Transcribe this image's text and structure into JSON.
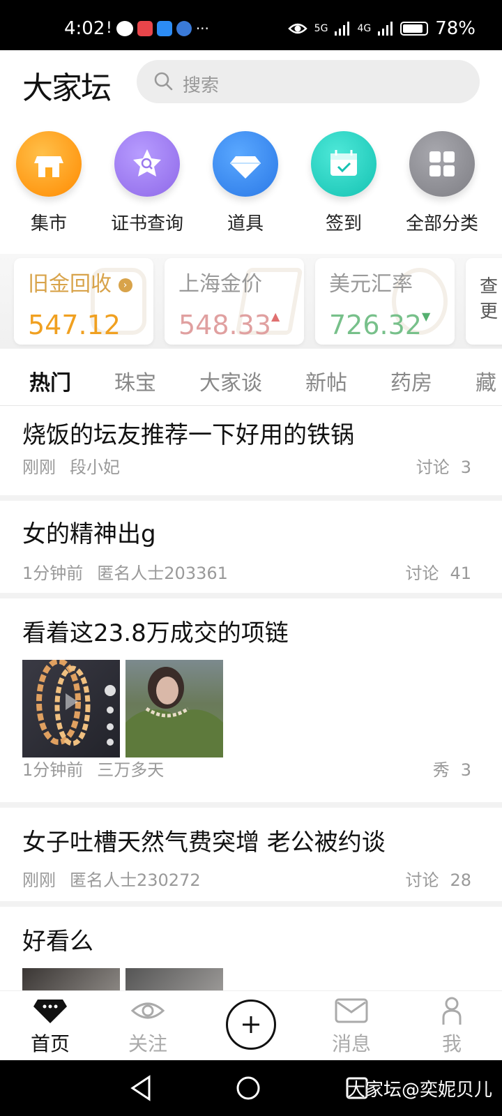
{
  "status_bar": {
    "time": "4:02",
    "network_1": "5G",
    "network_2": "4G",
    "battery": "78%"
  },
  "header": {
    "logo": "大家坛",
    "search_placeholder": "搜索"
  },
  "categories": [
    {
      "label": "集市",
      "icon": "store-icon",
      "color": "#ff9a1a"
    },
    {
      "label": "证书查询",
      "icon": "star-search-icon",
      "color": "#a07cf0"
    },
    {
      "label": "道具",
      "icon": "diamond-icon",
      "color": "#3b8ff0"
    },
    {
      "label": "签到",
      "icon": "calendar-check-icon",
      "color": "#22d3c5"
    },
    {
      "label": "全部分类",
      "icon": "grid-icon",
      "color": "#8e8e93"
    }
  ],
  "price_cards": [
    {
      "label": "旧金回收",
      "value": "547.12",
      "color": "#f0a020",
      "label_color": "#d8a34a"
    },
    {
      "label": "上海金价",
      "value": "548.33",
      "color": "#e0a0a0",
      "trend": "up"
    },
    {
      "label": "美元汇率",
      "value": "726.32",
      "color": "#77c08a",
      "trend": "down"
    },
    {
      "label": "查",
      "value": "更"
    }
  ],
  "tabs": [
    "热门",
    "珠宝",
    "大家谈",
    "新帖",
    "药房",
    "藏"
  ],
  "posts": [
    {
      "title": "烧饭的坛友推荐一下好用的铁锅",
      "time": "刚刚",
      "author": "段小妃",
      "tag": "讨论",
      "count": "3"
    },
    {
      "title": "女的精神出g",
      "time": "1分钟前",
      "author": "匿名人士203361",
      "tag": "讨论",
      "count": "41"
    },
    {
      "title": "看着这23.8万成交的项链",
      "time": "1分钟前",
      "author": "三万多天",
      "tag": "秀",
      "count": "3"
    },
    {
      "title": "女子吐槽天然气费突增 老公被约谈",
      "time": "刚刚",
      "author": "匿名人士230272",
      "tag": "讨论",
      "count": "28"
    },
    {
      "title": "好看么"
    }
  ],
  "bottom_nav": [
    {
      "label": "首页",
      "icon": "home-diamond-icon"
    },
    {
      "label": "关注",
      "icon": "eye-icon"
    },
    {
      "label": "",
      "icon": "plus-icon"
    },
    {
      "label": "消息",
      "icon": "mail-icon"
    },
    {
      "label": "我",
      "icon": "person-icon"
    }
  ],
  "watermark": "大家坛@奕妮贝儿"
}
